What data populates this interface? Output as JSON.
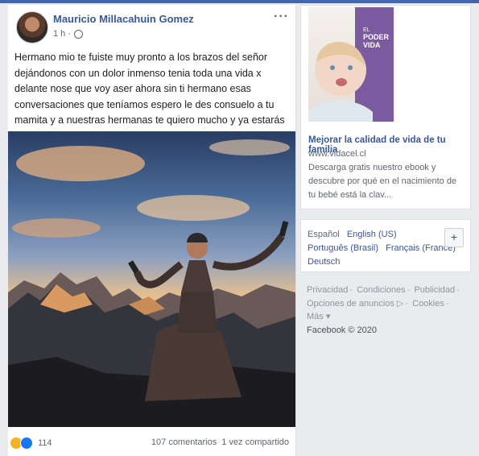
{
  "post": {
    "author": "Mauricio Millacahuin Gomez",
    "time": "1 h ·",
    "more": "···",
    "text": "Hermano mio te fuiste muy pronto a los brazos del señor dejándonos con un dolor inmenso tenia toda una vida x delante nose que voy aser ahora sin ti hermano esas conversaciones que teníamos espero le des consuelo a tu mamita y a nuestras hermanas te quiero mucho y ya estarás junto a nuestro padre te amo hermano de donde te encuentres",
    "reactions_count": "114",
    "comments": "107 comentarios",
    "shares": "1 vez compartido"
  },
  "ad": {
    "book_title_line1": "EL",
    "book_title_line2": "PODER",
    "book_title_line3": "VIDA",
    "title": "Mejorar la calidad de vida de tu familia",
    "url": "www.vidacel.cl",
    "description": "Descarga gratis nuestro ebook y descubre por qué en el nacimiento de tu bebé está la clav..."
  },
  "languages": {
    "current": "Español",
    "options": [
      "English (US)",
      "Português (Brasil)",
      "Français (France)",
      "Deutsch"
    ],
    "add": "+"
  },
  "footer": {
    "links": [
      "Privacidad",
      "Condiciones",
      "Publicidad",
      "Opciones de anuncios",
      "Cookies",
      "Más"
    ],
    "copyright": "Facebook © 2020"
  },
  "colors": {
    "brand": "#4267b2",
    "link": "#385898",
    "muted": "#606770"
  }
}
